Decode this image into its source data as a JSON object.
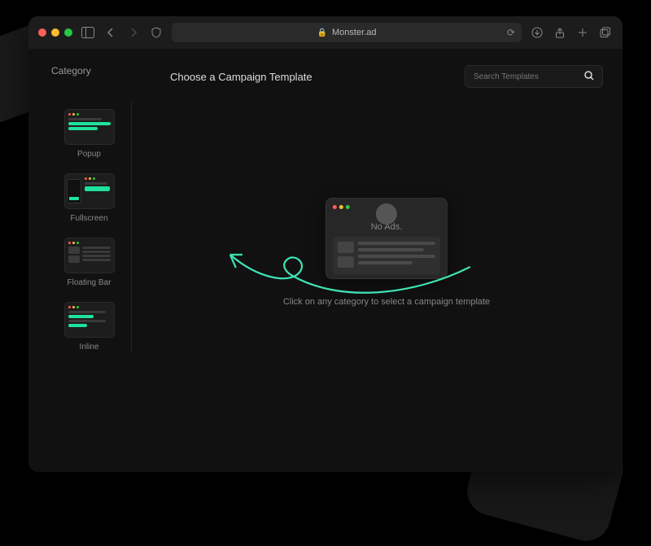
{
  "browser": {
    "url_label": "Monster.ad"
  },
  "sidebar": {
    "title": "Category",
    "items": [
      {
        "label": "Popup"
      },
      {
        "label": "Fullscreen"
      },
      {
        "label": "Floating Bar"
      },
      {
        "label": "Inline"
      }
    ]
  },
  "main": {
    "title": "Choose a Campaign Template",
    "search_placeholder": "Search Templates",
    "empty_card_title": "No Ads.",
    "empty_text": "Click on any category to select a campaign template"
  }
}
